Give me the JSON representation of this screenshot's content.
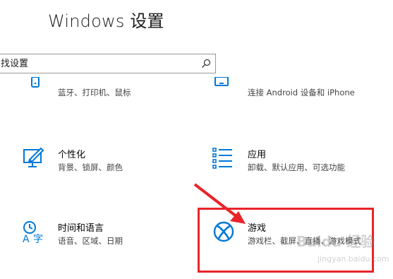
{
  "window": {
    "title": "Windows 设置"
  },
  "search": {
    "placeholder": "找设置"
  },
  "tiles": {
    "devices": {
      "desc": "蓝牙、打印机、鼠标"
    },
    "phone": {
      "desc": "连接 Android 设备和 iPhone"
    },
    "personalization": {
      "name": "个性化",
      "desc": "背景、锁屏、颜色"
    },
    "apps": {
      "name": "应用",
      "desc": "卸载、默认应用、可选功能"
    },
    "time_language": {
      "name": "时间和语言",
      "desc": "语音、区域、日期"
    },
    "gaming": {
      "name": "游戏",
      "desc": "游戏栏、截屏、直播、游戏模式"
    }
  },
  "watermark": {
    "text": "Baidu 经验",
    "url": "jingyan.baidu.com"
  },
  "colors": {
    "accent": "#0078d7",
    "highlight": "#e8242a"
  }
}
